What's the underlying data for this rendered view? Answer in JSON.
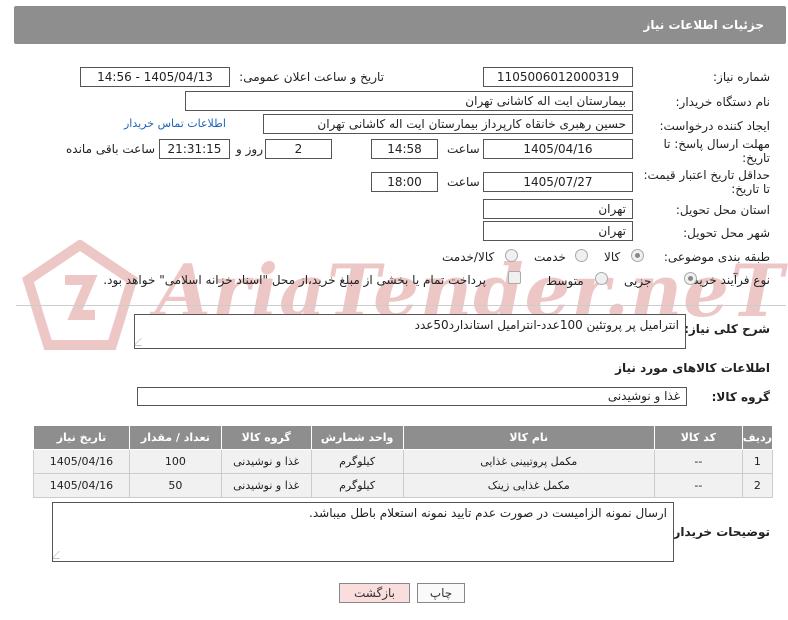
{
  "header": {
    "title": "جزئیات اطلاعات نیاز"
  },
  "fields": {
    "need_number_label": "شماره نیاز:",
    "need_number": "1105006012000319",
    "announce_label": "تاریخ و ساعت اعلان عمومی:",
    "announce_value": "1405/04/13 - 14:56",
    "buyer_org_label": "نام دستگاه خریدار:",
    "buyer_org": "بیمارستان ایت اله کاشانی تهران",
    "creator_label": "ایجاد کننده درخواست:",
    "creator": "حسین رهبری خانقاه کارپرداز بیمارستان ایت اله کاشانی تهران",
    "buyer_contact_link": "اطلاعات تماس خریدار",
    "reply_deadline_label_1": "مهلت ارسال پاسخ: تا",
    "reply_deadline_label_2": "تاریخ:",
    "reply_date": "1405/04/16",
    "time_label": "ساعت",
    "reply_time": "14:58",
    "days_value": "2",
    "days_label": "روز و",
    "remaining_time": "21:31:15",
    "remaining_label": "ساعت باقی مانده",
    "price_validity_label_1": "حداقل تاریخ اعتبار قیمت:",
    "price_validity_label_2": "تا تاریخ:",
    "validity_date": "1405/07/27",
    "validity_time": "18:00",
    "province_label": "استان محل تحویل:",
    "province": "تهران",
    "city_label": "شهر محل تحویل:",
    "city": "تهران",
    "category_label": "طبقه بندی موضوعی:",
    "category_options": [
      "کالا",
      "خدمت",
      "کالا/خدمت"
    ],
    "purchase_type_label": "نوع فرآیند خرید :",
    "purchase_options": [
      "جزیی",
      "متوسط"
    ],
    "payment_note": "پرداخت تمام یا بخشی از مبلغ خرید،از محل \"اسناد خزانه اسلامی\" خواهد بود."
  },
  "description": {
    "label": "شرح کلی نیاز:",
    "text": "انترامیل پر پروتئین 100عدد-انترامیل استاندارد50عدد"
  },
  "goods": {
    "section_title": "اطلاعات کالاهای مورد نیاز",
    "group_label": "گروه کالا:",
    "group_value": "غذا و نوشیدنی",
    "columns": [
      "ردیف",
      "کد کالا",
      "نام کالا",
      "واحد شمارش",
      "گروه کالا",
      "تعداد / مقدار",
      "تاریخ نیاز"
    ],
    "rows": [
      [
        "1",
        "--",
        "مکمل پروتیینی غذایی",
        "کیلوگرم",
        "غذا و نوشیدنی",
        "100",
        "1405/04/16"
      ],
      [
        "2",
        "--",
        "مکمل غذایی زینک",
        "کیلوگرم",
        "غذا و نوشیدنی",
        "50",
        "1405/04/16"
      ]
    ]
  },
  "buyer_notes": {
    "label": "توضیحات خریدار:",
    "text": "ارسال نمونه الزامیست در صورت عدم تایید نمونه استعلام باطل میباشد."
  },
  "buttons": {
    "print": "چاپ",
    "back": "بازگشت"
  },
  "watermark": {
    "text": "AriaTender.neT"
  }
}
